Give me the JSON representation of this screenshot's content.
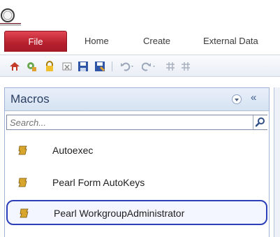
{
  "ribbon": {
    "tabs": [
      {
        "label": "File",
        "active": true
      },
      {
        "label": "Home"
      },
      {
        "label": "Create"
      },
      {
        "label": "External Data"
      }
    ]
  },
  "quick_access": {
    "icons": [
      "home-icon",
      "tools-icon",
      "lock-icon",
      "close-icon",
      "save-icon",
      "save-as-icon",
      "undo-icon",
      "redo-icon",
      "grid-icon",
      "grid-icon"
    ]
  },
  "nav_pane": {
    "title": "Macros",
    "collapse_glyph": "«",
    "search": {
      "placeholder": "Search...",
      "value": ""
    },
    "items": [
      {
        "label": "Autoexec",
        "selected": false
      },
      {
        "label": "Pearl Form AutoKeys",
        "selected": false
      },
      {
        "label": "Pearl WorkgroupAdministrator",
        "selected": true
      }
    ]
  },
  "colors": {
    "file_tab": "#b61f2e",
    "selection_outline": "#2a3fb8",
    "nav_header": "#d6e2f2"
  }
}
